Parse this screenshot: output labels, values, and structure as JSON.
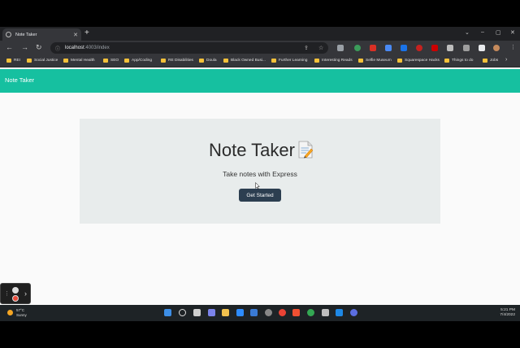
{
  "browser": {
    "tab_title": "Note Taker",
    "url_host": "localhost",
    "url_path": ":4003/index",
    "bookmarks": [
      "REI",
      "Social Justice",
      "Mental Health",
      "SEO",
      "App/Coding",
      "RE Disabilities",
      "Doula",
      "Black Owned Busi...",
      "Further Learning",
      "Interesting Reads",
      "Selfie Museum",
      "Squarespace Hacks",
      "Things to do",
      "Jobs"
    ]
  },
  "app": {
    "brand": "Note Taker",
    "heading": "Note Taker",
    "lead": "Take notes with Express",
    "cta_label": "Get Started"
  },
  "taskbar": {
    "temp": "57°C",
    "condition": "Sunny",
    "time": "5:21 PM",
    "date": "7/4/2022"
  },
  "colors": {
    "navbar": "#16c0a0",
    "button": "#2c3e50",
    "jumbotron": "#e8ecec"
  }
}
